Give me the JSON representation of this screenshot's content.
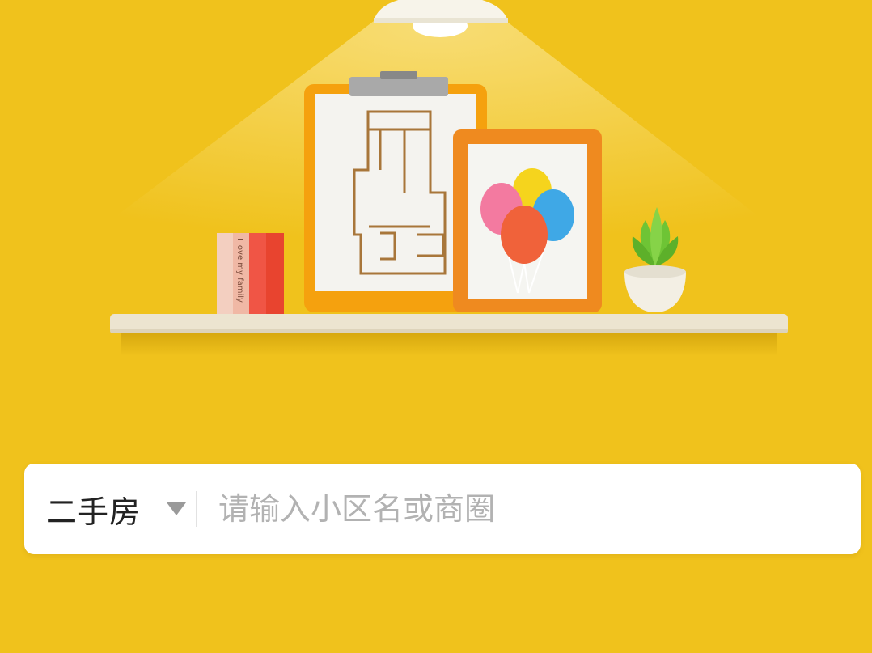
{
  "search": {
    "type_selected": "二手房",
    "placeholder": "请输入小区名或商圈"
  },
  "illustration": {
    "book_spine_text": "I love my family"
  },
  "icons": {
    "dropdown": "caret-down-icon"
  },
  "colors": {
    "background": "#f0c21c",
    "search_bg": "#ffffff",
    "placeholder": "#b2b2b2",
    "label": "#222222"
  }
}
